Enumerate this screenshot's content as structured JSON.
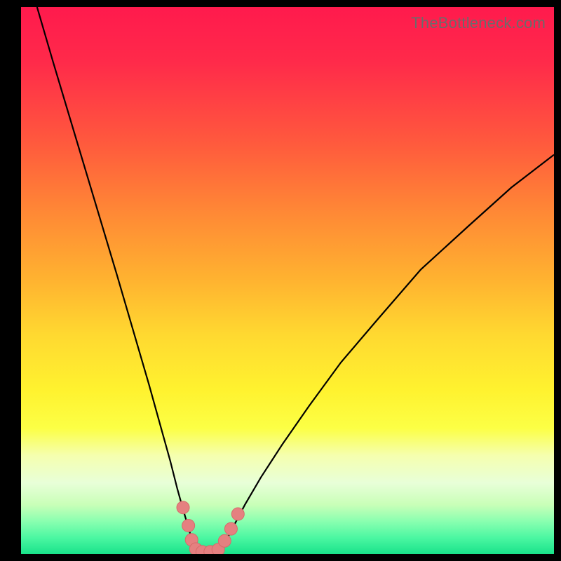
{
  "watermark": "TheBottleneck.com",
  "chart_data": {
    "type": "line",
    "title": "",
    "xlabel": "",
    "ylabel": "",
    "xlim": [
      0,
      100
    ],
    "ylim": [
      0,
      100
    ],
    "series": [
      {
        "name": "curve-left",
        "x": [
          3,
          6,
          10,
          14,
          18,
          21,
          24,
          26,
          28,
          29.3,
          30.3,
          31.2,
          31.8,
          32.3,
          33
        ],
        "y": [
          100,
          90,
          77,
          64,
          51,
          41,
          31,
          24,
          17,
          12,
          8.5,
          5.5,
          3.5,
          2,
          0.7
        ]
      },
      {
        "name": "curve-right",
        "x": [
          37.5,
          38.5,
          40,
          42,
          45,
          49,
          54,
          60,
          67,
          75,
          84,
          92,
          100
        ],
        "y": [
          0.7,
          2.5,
          5.3,
          9,
          14,
          20,
          27,
          35,
          43,
          52,
          60,
          67,
          73
        ]
      },
      {
        "name": "valley-floor",
        "x": [
          33,
          34,
          35.5,
          37.5
        ],
        "y": [
          0.7,
          0.3,
          0.3,
          0.7
        ]
      },
      {
        "name": "beads",
        "points": [
          {
            "x": 30.4,
            "y": 8.5
          },
          {
            "x": 31.4,
            "y": 5.2
          },
          {
            "x": 32.0,
            "y": 2.6
          },
          {
            "x": 32.8,
            "y": 0.9
          },
          {
            "x": 34.0,
            "y": 0.4
          },
          {
            "x": 35.5,
            "y": 0.4
          },
          {
            "x": 37.0,
            "y": 0.8
          },
          {
            "x": 38.2,
            "y": 2.4
          },
          {
            "x": 39.4,
            "y": 4.6
          },
          {
            "x": 40.7,
            "y": 7.3
          }
        ]
      }
    ],
    "colors": {
      "curve": "#000000",
      "bead_fill": "#e58080",
      "bead_stroke": "#d66a6a"
    }
  }
}
